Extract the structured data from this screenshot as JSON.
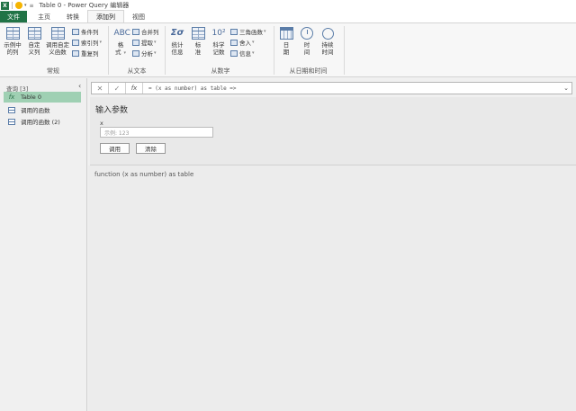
{
  "titlebar": {
    "app_badge": "X",
    "title": "Table 0 - Power Query 编辑器"
  },
  "tabs": [
    {
      "label": "文件"
    },
    {
      "label": "主页"
    },
    {
      "label": "转换"
    },
    {
      "label": "添加列"
    },
    {
      "label": "视图"
    }
  ],
  "ribbon": {
    "general": {
      "label": "常规",
      "example_col": "示例中\n的列",
      "custom_col": "自定\n义列",
      "invoke_custom": "调用自定\n义函数",
      "conditional_col": "条件列",
      "index_col": "索引列",
      "duplicate_col": "重复列"
    },
    "from_text": {
      "label": "从文本",
      "format": "格\n式",
      "merge_cols": "合并列",
      "extract": "提取",
      "parse": "分析"
    },
    "from_number": {
      "label": "从数字",
      "statistics": "统计\n信息",
      "standard": "标\n准",
      "scientific": "科学\n记数",
      "trig": "三角函数",
      "rounding": "舍入",
      "information": "信息"
    },
    "from_datetime": {
      "label": "从日期和时间",
      "date": "日\n期",
      "time": "时\n间",
      "duration": "持续\n时间"
    }
  },
  "queries": {
    "header": "查询 [3]",
    "items": [
      {
        "label": "Table 0",
        "icon": "fx-icon"
      },
      {
        "label": "调用的函数",
        "icon": "table-icon"
      },
      {
        "label": "调用的函数 (2)",
        "icon": "table-icon"
      }
    ]
  },
  "formula_bar": {
    "text": "= (x as number) as table =>"
  },
  "invoke": {
    "title": "输入参数",
    "param_label": "x",
    "param_placeholder": "示例: 123",
    "invoke_button": "调用",
    "clear_button": "清除"
  },
  "signature": "function (x as number) as table"
}
